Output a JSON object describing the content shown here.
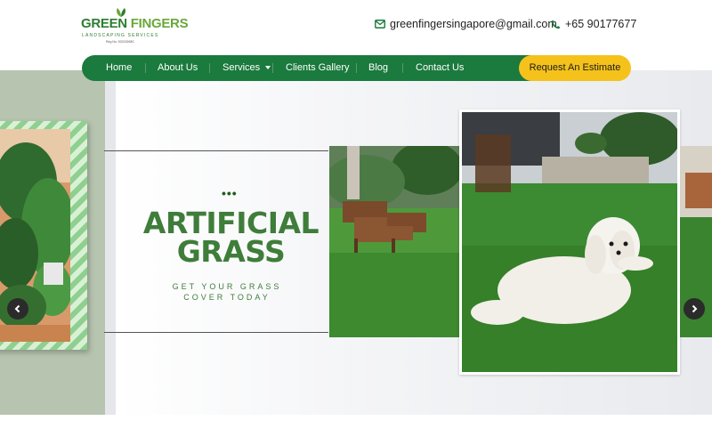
{
  "brand": {
    "name_part1": "GREEN",
    "name_part2": "FINGERS",
    "subtitle": "LANDSCAPING SERVICES",
    "reg_no": "Reg No: 53215268C",
    "colors": {
      "primary": "#1b7a3d",
      "accent": "#f5c21b",
      "headline": "#3f7d3a"
    }
  },
  "contact": {
    "email_icon": "envelope-icon",
    "email": "greenfingersingapore@gmail.com",
    "phone_icon": "phone-icon",
    "phone": "+65 90177677"
  },
  "nav": {
    "items": [
      {
        "label": "Home"
      },
      {
        "label": "About Us"
      },
      {
        "label": "Services",
        "has_dropdown": true
      },
      {
        "label": "Clients Gallery"
      },
      {
        "label": "Blog"
      },
      {
        "label": "Contact Us"
      }
    ],
    "cta_label": "Request An Estimate"
  },
  "hero": {
    "dots": "•••",
    "headline_line1": "ARTIFICIAL",
    "headline_line2": "GRASS",
    "tagline_line1": "GET YOUR GRASS",
    "tagline_line2": "COVER TODAY",
    "prev_icon": "chevron-left-icon",
    "next_icon": "chevron-right-icon"
  }
}
